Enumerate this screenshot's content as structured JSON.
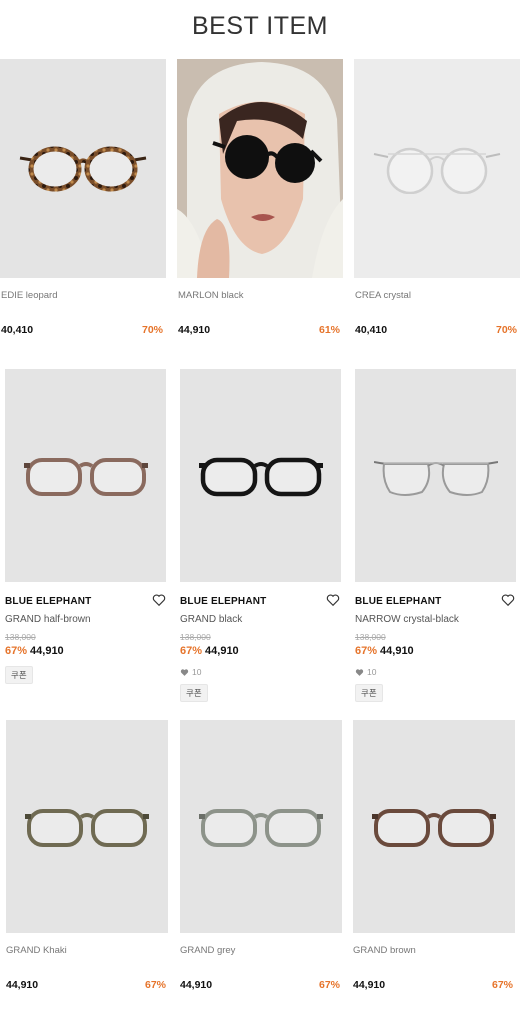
{
  "header": {
    "title": "BEST ITEM"
  },
  "row1": [
    {
      "name": "EDIE leopard",
      "price": "40,410",
      "discount": "70%",
      "frame_color": "#5a3a22",
      "style": "round-tort"
    },
    {
      "name": "MARLON black",
      "price": "44,910",
      "discount": "61%",
      "style": "photo"
    },
    {
      "name": "CREA crystal",
      "price": "40,410",
      "discount": "70%",
      "frame_color": "#c9c9c9",
      "style": "round-thin"
    }
  ],
  "row2": [
    {
      "brand": "BLUE ELEPHANT",
      "name": "GRAND half-brown",
      "original": "138,000",
      "pct": "67%",
      "price": "44,910",
      "likes": "",
      "coupon": "쿠폰",
      "frame_color": "#8a6a5e"
    },
    {
      "brand": "BLUE ELEPHANT",
      "name": "GRAND black",
      "original": "138,000",
      "pct": "67%",
      "price": "44,910",
      "likes": "10",
      "coupon": "쿠폰",
      "frame_color": "#151515"
    },
    {
      "brand": "BLUE ELEPHANT",
      "name": "NARROW crystal-black",
      "original": "138,000",
      "pct": "67%",
      "price": "44,910",
      "likes": "10",
      "coupon": "쿠폰",
      "frame_color": "#9a9a9a"
    }
  ],
  "row3": [
    {
      "name": "GRAND Khaki",
      "price": "44,910",
      "discount": "67%",
      "frame_color": "#6f6a52"
    },
    {
      "name": "GRAND grey",
      "price": "44,910",
      "discount": "67%",
      "frame_color": "#8d938a"
    },
    {
      "name": "GRAND brown",
      "price": "44,910",
      "discount": "67%",
      "frame_color": "#6a4a3c"
    }
  ],
  "colors": {
    "accent": "#e6742b",
    "image_bg": "#e4e4e4"
  }
}
